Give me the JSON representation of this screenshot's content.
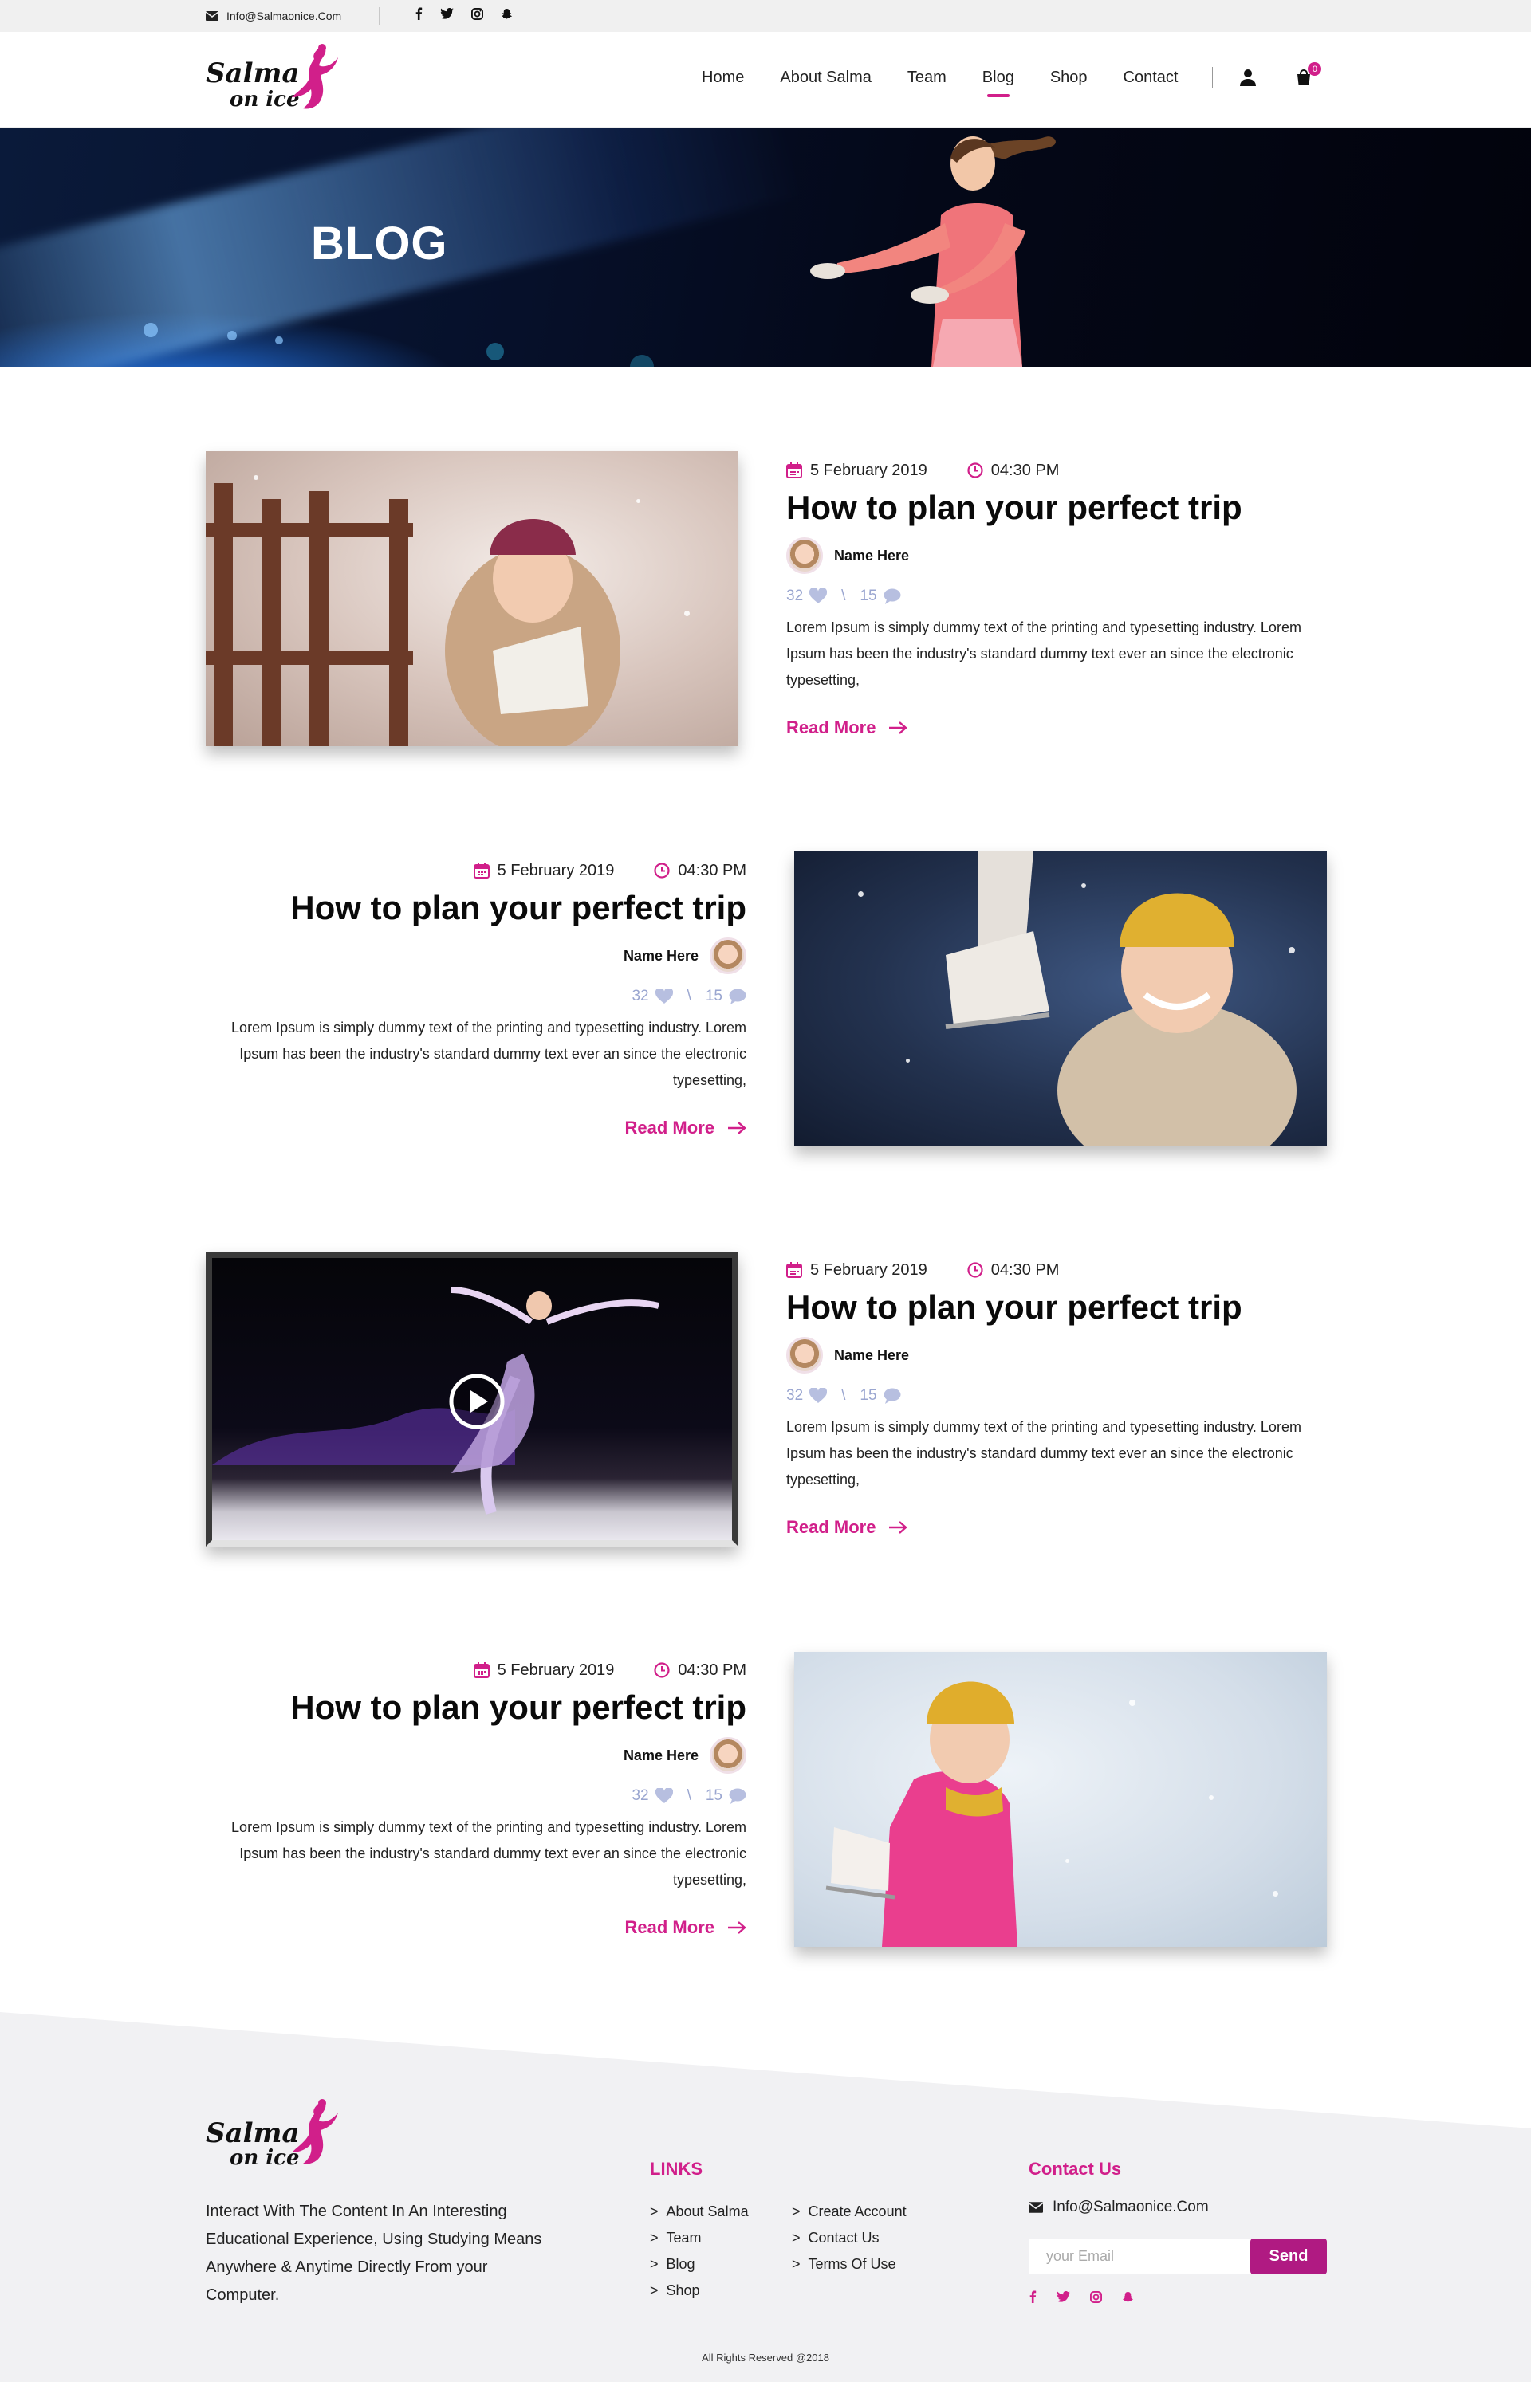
{
  "topbar": {
    "email": "Info@Salmaonice.Com",
    "socials": [
      "facebook-icon",
      "twitter-icon",
      "instagram-icon",
      "snapchat-icon"
    ]
  },
  "header": {
    "logo_line1": "Salma",
    "logo_line2": "on ice",
    "nav": [
      "Home",
      "About Salma",
      "Team",
      "Blog",
      "Shop",
      "Contact"
    ],
    "active_nav": "Blog",
    "cart_count": "0"
  },
  "hero": {
    "title": "BLOG"
  },
  "posts": [
    {
      "date": "5 February 2019",
      "time": "04:30 PM",
      "title": "How to plan your perfect trip",
      "author": "Name Here",
      "likes": "32",
      "comments": "15",
      "excerpt": "Lorem Ipsum is simply dummy text of the printing and typesetting industry. Lorem Ipsum has been the industry's standard dummy text ever an since the electronic typesetting,",
      "read_more": "Read More"
    },
    {
      "date": "5 February 2019",
      "time": "04:30 PM",
      "title": "How to plan your perfect trip",
      "author": "Name Here",
      "likes": "32",
      "comments": "15",
      "excerpt": "Lorem Ipsum is simply dummy text of the printing and typesetting industry. Lorem Ipsum has been the industry's standard dummy text ever an since the electronic typesetting,",
      "read_more": "Read More"
    },
    {
      "date": "5 February 2019",
      "time": "04:30 PM",
      "title": "How to plan your perfect trip",
      "author": "Name Here",
      "likes": "32",
      "comments": "15",
      "excerpt": "Lorem Ipsum is simply dummy text of the printing and typesetting industry. Lorem Ipsum has been the industry's standard dummy text ever an since the electronic typesetting,",
      "read_more": "Read More"
    },
    {
      "date": "5 February 2019",
      "time": "04:30 PM",
      "title": "How to plan your perfect trip",
      "author": "Name Here",
      "likes": "32",
      "comments": "15",
      "excerpt": "Lorem Ipsum is simply dummy text of the printing and typesetting industry. Lorem Ipsum has been the industry's standard dummy text ever an since the electronic typesetting,",
      "read_more": "Read More"
    }
  ],
  "footer": {
    "logo_line1": "Salma",
    "logo_line2": "on ice",
    "about": "Interact With The Content In An Interesting Educational Experience, Using Studying Means Anywhere & Anytime Directly From your Computer.",
    "links_title": "LINKS",
    "links_col1": [
      "About Salma",
      "Team",
      "Blog",
      "Shop"
    ],
    "links_col2": [
      "Create Account",
      "Contact Us",
      "Terms Of Use"
    ],
    "contact_title": "Contact Us",
    "contact_email": "Info@Salmaonice.Com",
    "email_placeholder": "your Email",
    "send_label": "Send",
    "socials": [
      "facebook-icon",
      "twitter-icon",
      "instagram-icon",
      "snapchat-icon"
    ],
    "copyright": "All Rights Reserved @2018"
  },
  "colors": {
    "accent": "#d11f8a",
    "send_button": "#b01a82",
    "stats": "#9aa6d0",
    "footer_bg": "#f1f1f3"
  }
}
